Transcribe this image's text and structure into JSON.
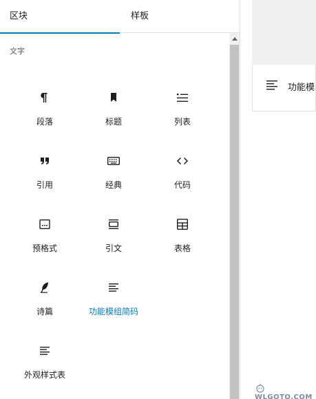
{
  "tabs": [
    {
      "label": "区块",
      "active": true
    },
    {
      "label": "样板",
      "active": false
    }
  ],
  "category": {
    "title": "文字"
  },
  "blocks": [
    {
      "label": "段落",
      "icon": "paragraph-icon"
    },
    {
      "label": "标题",
      "icon": "bookmark-icon"
    },
    {
      "label": "列表",
      "icon": "list-icon"
    },
    {
      "label": "引用",
      "icon": "quote-icon"
    },
    {
      "label": "经典",
      "icon": "keyboard-icon"
    },
    {
      "label": "代码",
      "icon": "code-icon"
    },
    {
      "label": "预格式",
      "icon": "preformatted-icon"
    },
    {
      "label": "引文",
      "icon": "pullquote-icon"
    },
    {
      "label": "表格",
      "icon": "table-icon"
    },
    {
      "label": "诗篇",
      "icon": "verse-feather-icon"
    },
    {
      "label": "功能模组简码",
      "icon": "shortcode-lines-icon",
      "highlighted": true
    },
    {
      "label": "外观样式表",
      "icon": "stylesheet-lines-icon"
    }
  ],
  "canvas": {
    "block_text": "功能模组"
  },
  "watermark": {
    "text": "WLGOTO.COM"
  },
  "colors": {
    "accent": "#007cba",
    "border": "#e0e0e0",
    "canvas_bg": "#f0f0f0"
  }
}
